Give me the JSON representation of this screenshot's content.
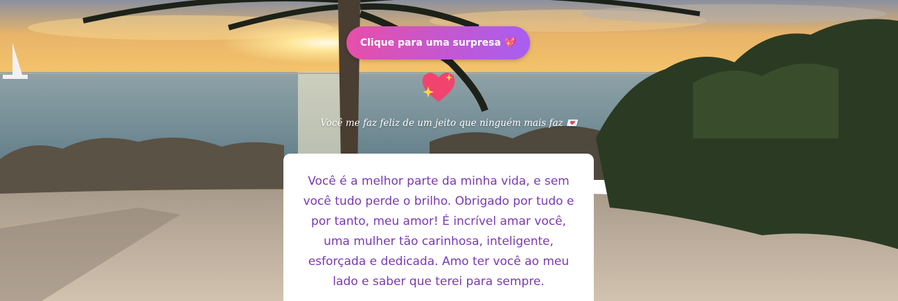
{
  "button": {
    "label": "Clique para uma surpresa 💖"
  },
  "heart": {
    "icon": "sparkling-heart-icon"
  },
  "subtitle": "Você me faz feliz de um jeito que ninguém mais faz 💌",
  "message": "Você é a melhor parte da minha vida, e sem você tudo perde o brilho. Obrigado por tudo e por tanto, meu amor! É incrível amar você, uma mulher tão carinhosa, inteligente, esforçada e dedicada. Amo ter você ao meu lado e saber que terei para sempre.",
  "colors": {
    "button_gradient_start": "#e64fa9",
    "button_gradient_end": "#a85ef2",
    "message_text": "#7a38b6",
    "card_background": "#ffffff"
  }
}
